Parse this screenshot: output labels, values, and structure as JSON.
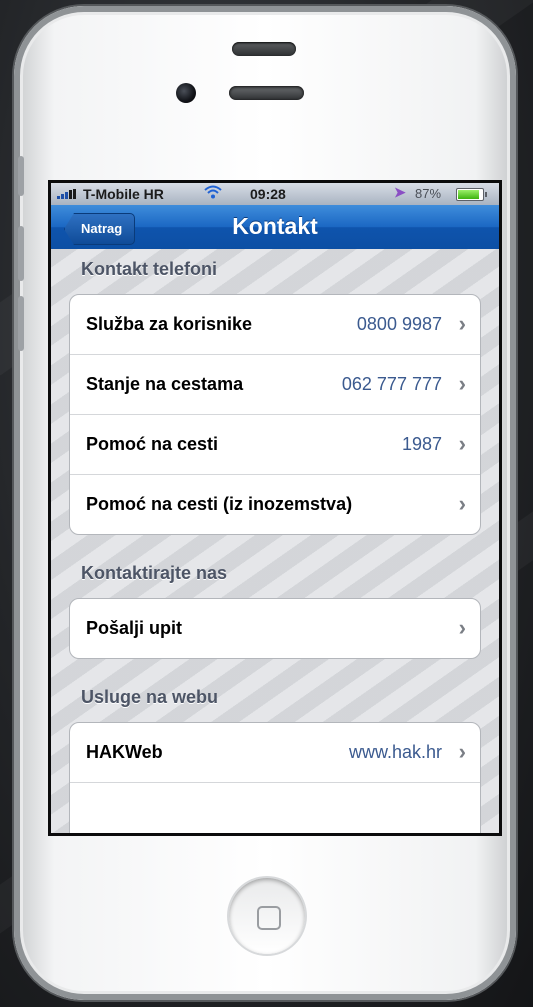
{
  "status_bar": {
    "carrier": "T-Mobile HR",
    "time": "09:28",
    "battery_percent": "87%",
    "battery_level": 0.87,
    "icons": [
      "signal-icon",
      "wifi-icon",
      "location-icon",
      "battery-icon"
    ]
  },
  "nav_bar": {
    "back_label": "Natrag",
    "title": "Kontakt"
  },
  "sections": {
    "phones": {
      "header": "Kontakt telefoni",
      "rows": [
        {
          "label": "Služba za korisnike",
          "value": "0800 9987"
        },
        {
          "label": "Stanje na cestama",
          "value": "062 777 777"
        },
        {
          "label": "Pomoć na cesti",
          "value": "1987"
        },
        {
          "label": "Pomoć na cesti (iz inozemstva)",
          "value": ""
        }
      ]
    },
    "contact_us": {
      "header": "Kontaktirajte nas",
      "rows": [
        {
          "label": "Pošalji upit",
          "value": ""
        }
      ]
    },
    "web": {
      "header": "Usluge na webu",
      "rows": [
        {
          "label": "HAKWeb",
          "value": "www.hak.hr"
        }
      ]
    }
  },
  "colors": {
    "nav_blue": "#1b67c3",
    "value_blue": "#3b5a8f",
    "section_header": "#4d5566"
  }
}
